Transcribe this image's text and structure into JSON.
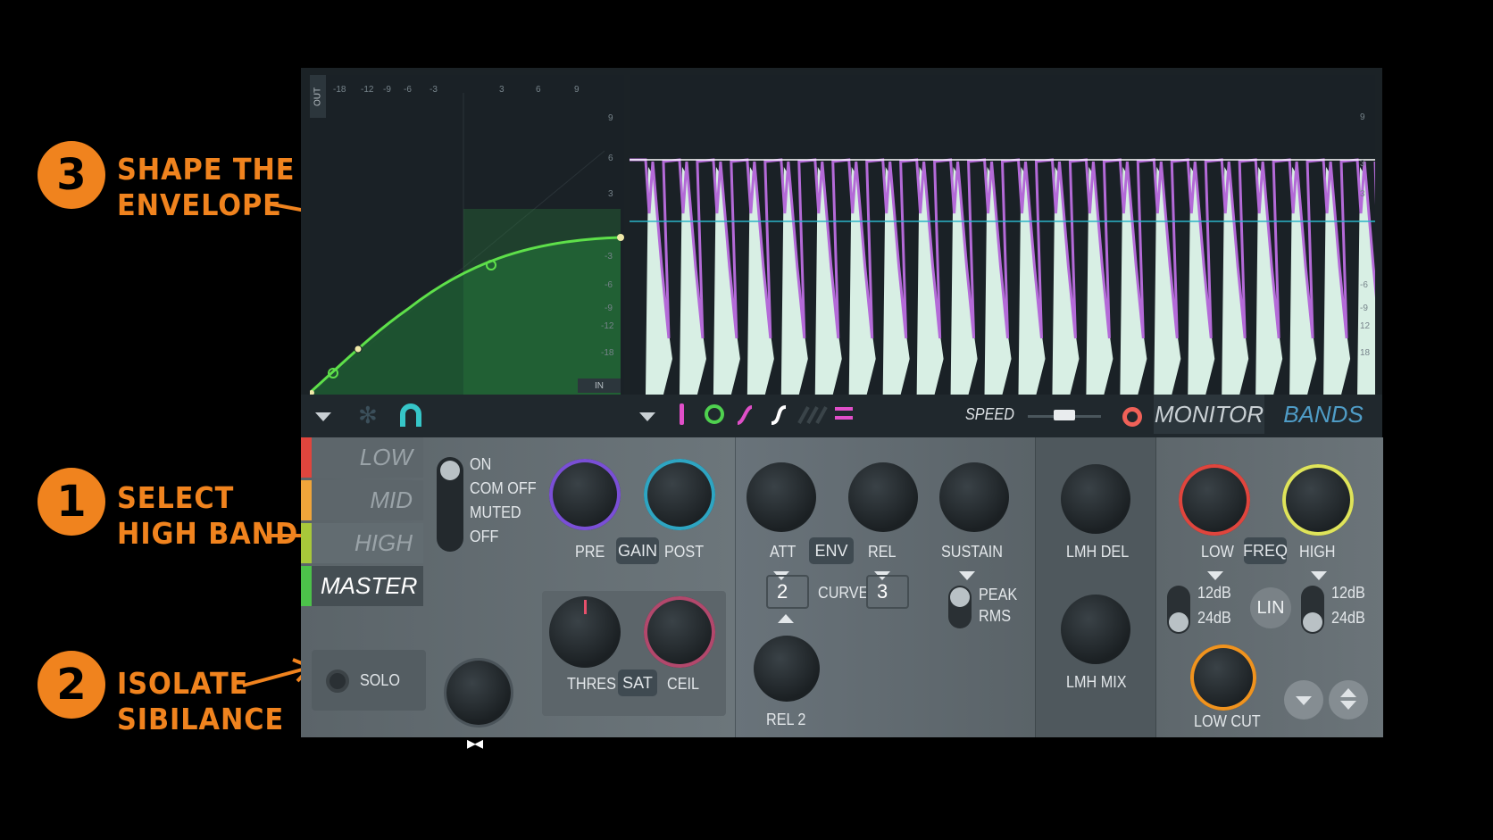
{
  "annotations": {
    "step1": {
      "number": "1",
      "line1": "SELECT",
      "line2": "HIGH BAND"
    },
    "step2": {
      "number": "2",
      "line1": "ISOLATE",
      "line2": "SIBILANCE"
    },
    "step3": {
      "number": "3",
      "line1": "SHAPE THE",
      "line2": "ENVELOPE"
    },
    "accent_color": "#f0831e"
  },
  "envelope_graph": {
    "out_label": "OUT",
    "in_label": "IN",
    "x_ticks": [
      "-18",
      "-12",
      "-9",
      "-6",
      "-3",
      "3",
      "6",
      "9"
    ],
    "y_ticks": [
      "9",
      "6",
      "3",
      "-3",
      "-6",
      "-9",
      "-12",
      "-18"
    ],
    "curve_color": "#5ee04a"
  },
  "waveform": {
    "right_ticks": [
      "9",
      "3",
      "3",
      "-6",
      "-9",
      "12",
      "18"
    ],
    "fill_color": "#d8efe4",
    "envelope_color": "#b46ad8",
    "threshold_color": "#2bb3c7"
  },
  "toolbar": {
    "speed_label": "SPEED",
    "speed_level": 0.5,
    "monitor_label": "MONITOR",
    "bands_label": "BANDS",
    "icons": [
      "chevron-down-icon",
      "snowflake-icon",
      "magnet-icon",
      "chevron-down-icon",
      "line-tool-icon",
      "circle-tool-icon",
      "curve-tool-icon",
      "s-curve-tool-icon",
      "multi-curve-tool-icon",
      "equals-icon",
      "record-icon"
    ]
  },
  "bands": {
    "tabs": [
      {
        "label": "LOW",
        "color": "#e0453d"
      },
      {
        "label": "MID",
        "color": "#f0a53a"
      },
      {
        "label": "HIGH",
        "color": "#a8c83a"
      },
      {
        "label": "MASTER",
        "color": "#4cc24a"
      }
    ],
    "selected": "HIGH",
    "solo_label": "SOLO"
  },
  "mode_switch": {
    "options": [
      "ON",
      "COM OFF",
      "MUTED",
      "OFF"
    ]
  },
  "gain": {
    "pre_label": "PRE",
    "gain_label": "GAIN",
    "post_label": "POST",
    "thres_label": "THRES",
    "sat_label": "SAT",
    "ceil_label": "CEIL"
  },
  "envelope": {
    "att_label": "ATT",
    "env_label": "ENV",
    "rel_label": "REL",
    "sustain_label": "SUSTAIN",
    "curve_left": "2",
    "curve_label": "CURVE",
    "curve_right": "3",
    "peak_label": "PEAK",
    "rms_label": "RMS",
    "rel2_label": "REL 2"
  },
  "lmh": {
    "del_label": "LMH DEL",
    "mix_label": "LMH MIX"
  },
  "crossover": {
    "low_label": "LOW",
    "freq_label": "FREQ",
    "high_label": "HIGH",
    "low_12": "12dB",
    "low_24": "24dB",
    "lin_label": "LIN",
    "high_12": "12dB",
    "high_24": "24dB",
    "lowcut_label": "LOW CUT"
  }
}
